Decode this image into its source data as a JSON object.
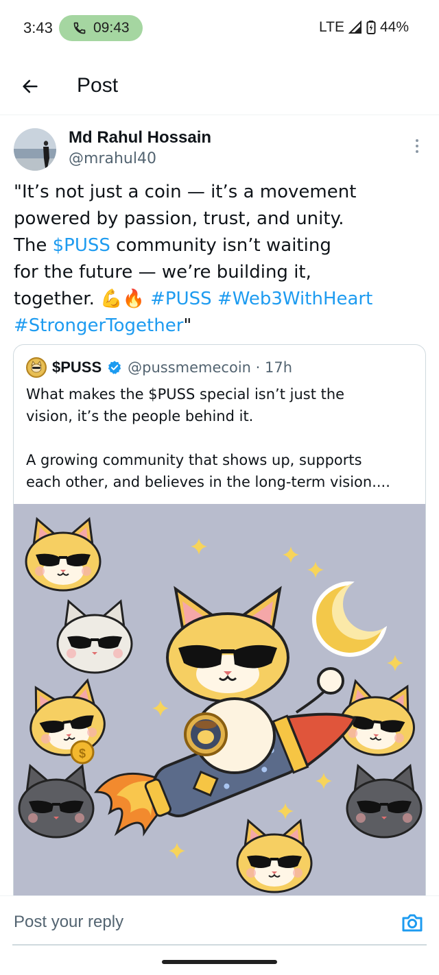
{
  "status_bar": {
    "time": "3:43",
    "call_time": "09:43",
    "network": "LTE",
    "battery": "44%"
  },
  "header": {
    "title": "Post",
    "back_icon": "arrow-left-icon"
  },
  "post": {
    "author_name": "Md Rahul Hossain",
    "author_handle": "@mrahul40",
    "text": {
      "l1": "\"It’s not just a coin — it’s a movement",
      "l2": "powered by passion, trust, and unity.",
      "l3_a": "The ",
      "l3_link": "$PUSS",
      "l3_b": " community isn’t waiting",
      "l4": "for the future — we’re building it,",
      "l5_a": "together. 💪🔥 ",
      "l5_tag1": "#PUSS",
      "l5_sp": " ",
      "l5_tag2": "#Web3WithHeart",
      "l6_tag": "#StrongerTogether",
      "l6_end": "\""
    },
    "quote": {
      "name": "$PUSS",
      "handle_time": "@pussmemecoin · 17h",
      "verified_icon": "verified-badge-icon",
      "lines": {
        "l1": "What makes the $PUSS special isn’t just the",
        "l2": "vision, it’s the people behind it.",
        "l3": "A growing community that shows up, supports",
        "l4": "each other, and believes in the long-term vision...."
      },
      "image_alt": "Cartoon cats in sunglasses riding a rocket with a moon and sparkles"
    }
  },
  "reply": {
    "placeholder": "Post your reply",
    "camera_icon": "camera-icon"
  },
  "colors": {
    "link": "#1d9bf0",
    "call_pill": "#a5d6a1",
    "text": "#0f1419",
    "muted": "#536471"
  }
}
